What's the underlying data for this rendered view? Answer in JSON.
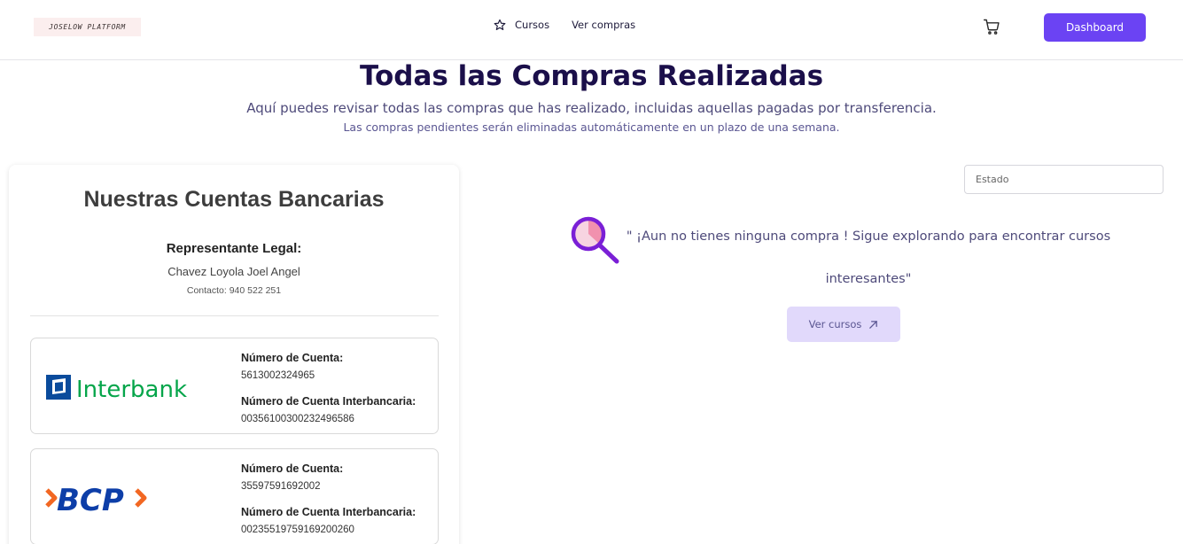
{
  "header": {
    "logo_text": "JOSELOW PLATFORM",
    "nav": {
      "courses_label": "Cursos",
      "purchases_label": "Ver compras"
    },
    "dashboard_label": "Dashboard"
  },
  "main": {
    "title": "Todas las Compras Realizadas",
    "subtitle": "Aquí puedes revisar todas las compras que has realizado, incluidas aquellas pagadas por transferencia.",
    "note": "Las compras pendientes serán eliminadas automáticamente en un plazo de una semana."
  },
  "bank_panel": {
    "title": "Nuestras Cuentas Bancarias",
    "representative_label": "Representante Legal:",
    "representative_name": "Chavez Loyola Joel Angel",
    "contact": "Contacto: 940 522 251",
    "accounts": [
      {
        "bank": "Interbank",
        "account_label": "Número de Cuenta:",
        "account_number": "5613002324965",
        "cci_label": "Número de Cuenta Interbancaria:",
        "cci_number": "00356100300232496586"
      },
      {
        "bank": "BCP",
        "account_label": "Número de Cuenta:",
        "account_number": "35597591692002",
        "cci_label": "Número de Cuenta Interbancaria:",
        "cci_number": "00235519759169200260"
      }
    ]
  },
  "filter": {
    "estado_placeholder": "Estado"
  },
  "empty_state": {
    "message": "\" ¡Aun no tienes ninguna compra ! Sigue explorando para encontrar cursos interesantes\"",
    "button_label": "Ver cursos"
  },
  "colors": {
    "accent": "#6b43f3",
    "title": "#1b0f4a",
    "interbank_green": "#05a54a",
    "interbank_blue": "#0a4b9c",
    "bcp_blue": "#0d3ea8",
    "bcp_orange": "#f26722"
  },
  "icons": [
    "star-icon",
    "cart-icon",
    "search-magnifier-icon",
    "arrow-up-right-icon"
  ]
}
